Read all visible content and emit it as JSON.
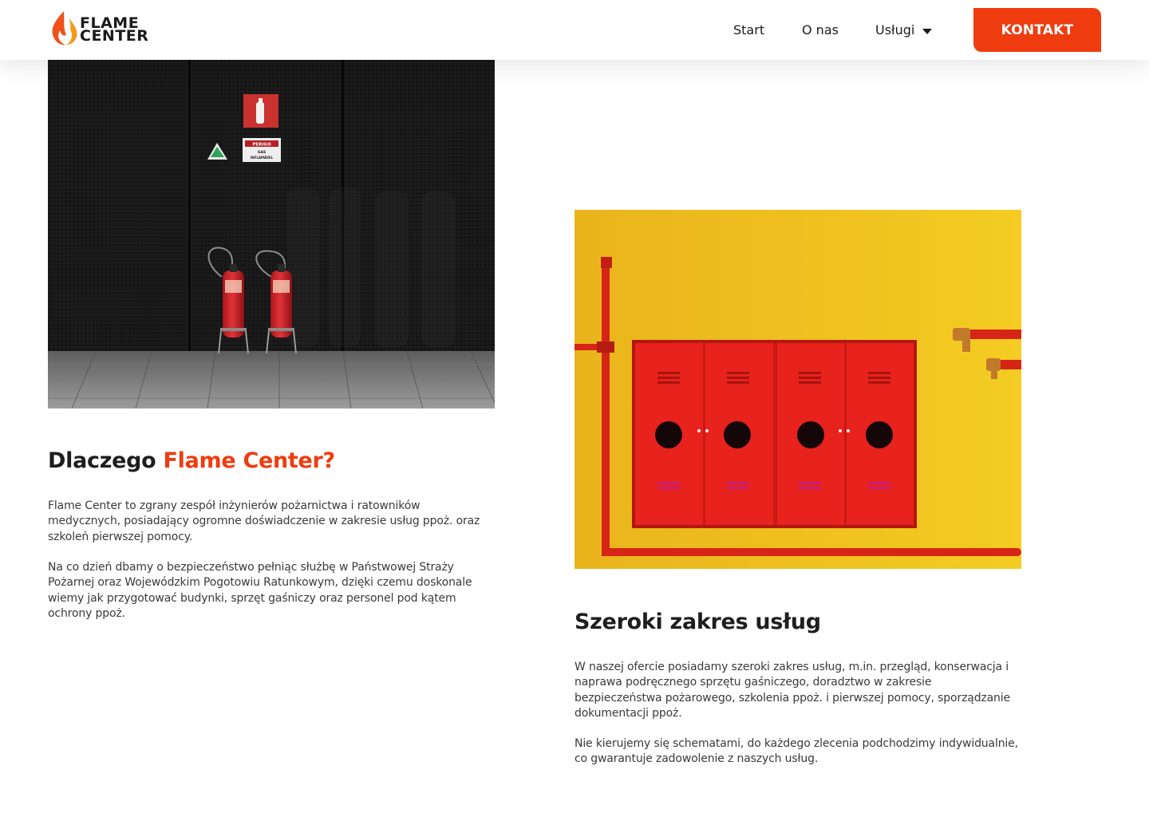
{
  "header": {
    "logo": {
      "line1": "FLAME",
      "line2": "CENTER"
    },
    "nav": [
      {
        "label": "Start"
      },
      {
        "label": "O nas"
      },
      {
        "label": "Usługi"
      }
    ],
    "cta_label": "KONTAKT"
  },
  "section_left": {
    "heading_plain": "Dlaczego ",
    "heading_accent": "Flame Center?",
    "paragraphs": [
      "Flame Center to zgrany zespół inżynierów pożarnictwa i ratowników medycznych, posiadający ogromne doświadczenie w zakresie usług ppoż. oraz szkoleń pierwszej pomocy.",
      "Na co dzień dbamy o bezpieczeństwo pełniąc służbę w Państwowej Straży Pożarnej oraz Wojewódzkim Pogotowiu Ratunkowym, dzięki czemu doskonale wiemy jak przygotować budynki, sprzęt gaśniczy oraz personel pod kątem ochrony ppoż."
    ],
    "image": {
      "sign_line1": "PERIGO",
      "sign_line2": "GAS",
      "sign_line3": "INFLAMÁVEL"
    }
  },
  "section_right": {
    "heading": "Szeroki zakres usług",
    "paragraphs": [
      "W naszej ofercie posiadamy szeroki zakres usług, m.in. przegląd, konserwacja i naprawa podręcznego sprzętu gaśniczego, doradztwo w zakresie bezpieczeństwa pożarowego, szkolenia ppoż. i pierwszej pomocy, sporządzanie dokumentacji ppoż.",
      "Nie kierujemy się schematami, do każdego zlecenia podchodzimy indywidualnie, co gwarantuje zadowolenie z naszych usług."
    ]
  },
  "colors": {
    "accent": "#ee3c0f",
    "text_dark": "#1e1e1e",
    "wall_yellow": "#f2bd1d",
    "cabinet_red": "#e8221c"
  }
}
